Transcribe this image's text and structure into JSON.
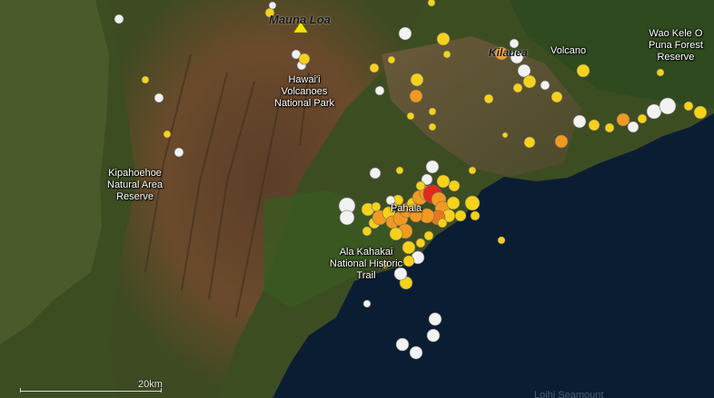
{
  "map": {
    "places": {
      "mauna_loa": "Mauna Loa",
      "hawaii_volcanoes": "Hawai'i\nVolcanoes\nNational Park",
      "volcano": "Volcano",
      "wao_kele": "Wao Kele O\nPuna Forest\nReserve",
      "kipahoehoe": "Kipahoehoe\nNatural Area\nReserve",
      "pahala": "Pahala",
      "ala_kahakai": "Ala Kahakai\nNational Historic\nTrail",
      "kilauea": "Kilauea",
      "loihi": "Loihi Seamount"
    },
    "scale_label": "20km"
  },
  "earthquakes_legend": {
    "white": "#f2f2f2",
    "yellow": "#f6d21a",
    "orange": "#f29a1f",
    "dark_orange": "#e8761c",
    "red": "#e0281c",
    "summit_marker": "#f5e400"
  }
}
